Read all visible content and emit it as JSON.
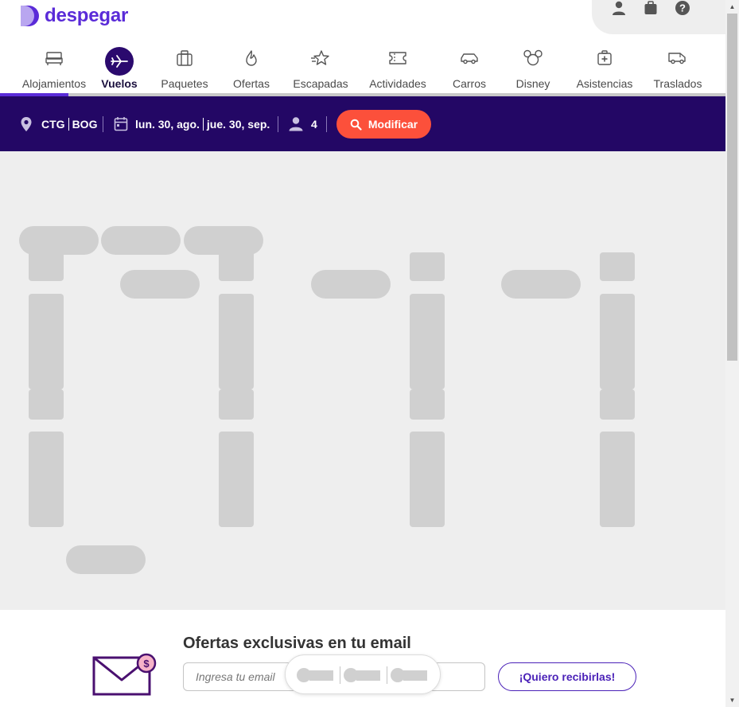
{
  "brand": {
    "name": "despegar",
    "color": "#5a2bd8"
  },
  "header_icons": [
    {
      "icon": "user-icon"
    },
    {
      "icon": "suitcase-icon"
    },
    {
      "icon": "help-icon"
    }
  ],
  "nav": {
    "items": [
      {
        "id": "alojamientos",
        "label": "Alojamientos",
        "icon": "bed-icon"
      },
      {
        "id": "vuelos",
        "label": "Vuelos",
        "icon": "plane-icon",
        "active": true
      },
      {
        "id": "paquetes",
        "label": "Paquetes",
        "icon": "luggage-icon"
      },
      {
        "id": "ofertas",
        "label": "Ofertas",
        "icon": "flame-icon"
      },
      {
        "id": "escapadas",
        "label": "Escapadas",
        "icon": "star-icon"
      },
      {
        "id": "actividades",
        "label": "Actividades",
        "icon": "ticket-icon"
      },
      {
        "id": "carros",
        "label": "Carros",
        "icon": "car-icon"
      },
      {
        "id": "disney",
        "label": "Disney",
        "icon": "mickey-icon"
      },
      {
        "id": "asistencias",
        "label": "Asistencias",
        "icon": "medical-kit-icon"
      },
      {
        "id": "traslados",
        "label": "Traslados",
        "icon": "van-icon"
      }
    ]
  },
  "search_summary": {
    "origin": "CTG",
    "destination": "BOG",
    "departure": "lun. 30, ago.",
    "return": "jue. 30, sep.",
    "passengers": "4",
    "modify_label": "Modificar",
    "bar_color": "#230765",
    "button_color": "#fc503b"
  },
  "newsletter": {
    "title": "Ofertas exclusivas en tu email",
    "email_placeholder": "Ingresa tu email",
    "email_value": "",
    "subscribe_label": "¡Quiero recibirlas!"
  }
}
